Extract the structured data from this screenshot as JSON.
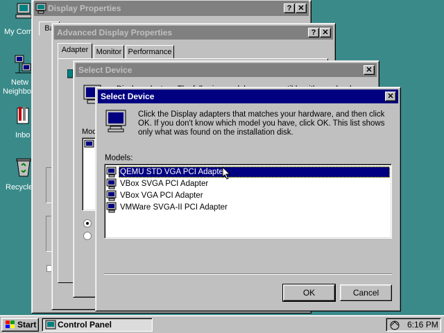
{
  "desktop": {
    "icons": [
      {
        "label": "My Com"
      },
      {
        "label": "Netw"
      },
      {
        "label": "Neighbo"
      },
      {
        "label": "Inbo"
      },
      {
        "label": "Recycle"
      }
    ]
  },
  "display_properties": {
    "title": "Display Properties",
    "tab_fragment": "Ba"
  },
  "advanced": {
    "title": "Advanced Display Properties",
    "tabs": [
      "Adapter",
      "Monitor",
      "Performance"
    ]
  },
  "select_device_back": {
    "title": "Select Device",
    "text_fragment": "Display adapters: The following models are compatible with your hardware.",
    "models_fragment": "Mode"
  },
  "dialog": {
    "title": "Select Device",
    "description": "Click the Display adapters that matches your hardware, and then click OK. If you don't know which model you have, click OK. This list shows only what was found on the installation disk.",
    "models_label": "Models:",
    "models": [
      {
        "label": "QEMU STD VGA PCI Adapter",
        "selected": true
      },
      {
        "label": "VBox SVGA PCI Adapter",
        "selected": false
      },
      {
        "label": "VBox VGA PCI Adapter",
        "selected": false
      },
      {
        "label": "VMWare SVGA-II PCI Adapter",
        "selected": false
      }
    ],
    "ok_label": "OK",
    "cancel_label": "Cancel",
    "help_glyph": "?",
    "close_glyph": "✕"
  },
  "taskbar": {
    "start_label": "Start",
    "task_label": "Control Panel",
    "time": "6:16 PM"
  },
  "colors": {
    "desktop": "#3a8a8a",
    "active_title": "#000080",
    "inactive_title": "#808080",
    "face": "#c0c0c0"
  }
}
